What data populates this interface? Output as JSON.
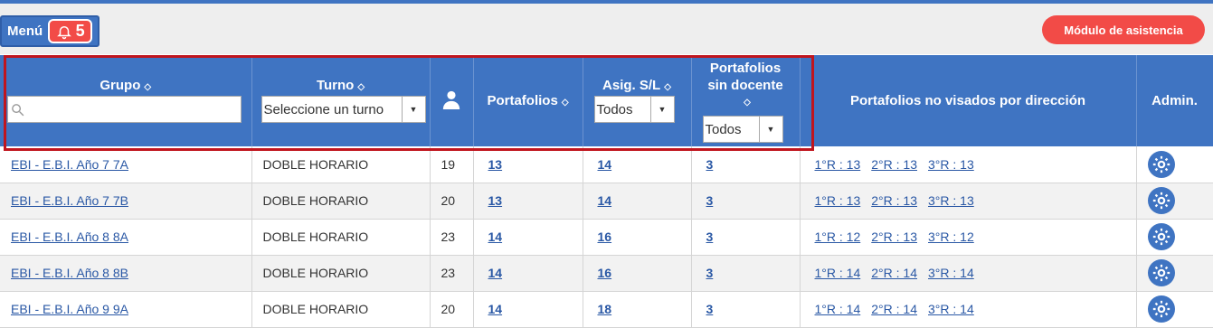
{
  "header": {
    "menu_label": "Menú",
    "notification_count": "5",
    "attendance_button": "Módulo de asistencia"
  },
  "table": {
    "columns": {
      "grupo": "Grupo",
      "turno": "Turno",
      "portafolios": "Portafolios",
      "asig": "Asig. S/L",
      "sin_docente_1": "Portafolios",
      "sin_docente_2": "sin docente",
      "no_visados": "Portafolios no visados por dirección",
      "admin": "Admin."
    },
    "filters": {
      "grupo_search_value": "",
      "turno_select": "Seleccione un turno",
      "asig_select": "Todos",
      "sin_docente_select": "Todos"
    },
    "rows": [
      {
        "grupo": "EBI - E.B.I. Año 7 7A",
        "turno": "DOBLE HORARIO",
        "alumnos": "19",
        "portafolios": "13",
        "asig": "14",
        "sin_docente": "3",
        "r1": "1°R : 13",
        "r2": "2°R : 13",
        "r3": "3°R : 13"
      },
      {
        "grupo": "EBI - E.B.I. Año 7 7B",
        "turno": "DOBLE HORARIO",
        "alumnos": "20",
        "portafolios": "13",
        "asig": "14",
        "sin_docente": "3",
        "r1": "1°R : 13",
        "r2": "2°R : 13",
        "r3": "3°R : 13"
      },
      {
        "grupo": "EBI - E.B.I. Año 8 8A",
        "turno": "DOBLE HORARIO",
        "alumnos": "23",
        "portafolios": "14",
        "asig": "16",
        "sin_docente": "3",
        "r1": "1°R : 12",
        "r2": "2°R : 13",
        "r3": "3°R : 12"
      },
      {
        "grupo": "EBI - E.B.I. Año 8 8B",
        "turno": "DOBLE HORARIO",
        "alumnos": "23",
        "portafolios": "14",
        "asig": "16",
        "sin_docente": "3",
        "r1": "1°R : 14",
        "r2": "2°R : 14",
        "r3": "3°R : 14"
      },
      {
        "grupo": "EBI - E.B.I. Año 9 9A",
        "turno": "DOBLE HORARIO",
        "alumnos": "20",
        "portafolios": "14",
        "asig": "18",
        "sin_docente": "3",
        "r1": "1°R : 14",
        "r2": "2°R : 14",
        "r3": "3°R : 14"
      }
    ]
  },
  "colors": {
    "primary": "#3f74c2",
    "accent": "#f24b47",
    "highlight": "#c0151e"
  }
}
